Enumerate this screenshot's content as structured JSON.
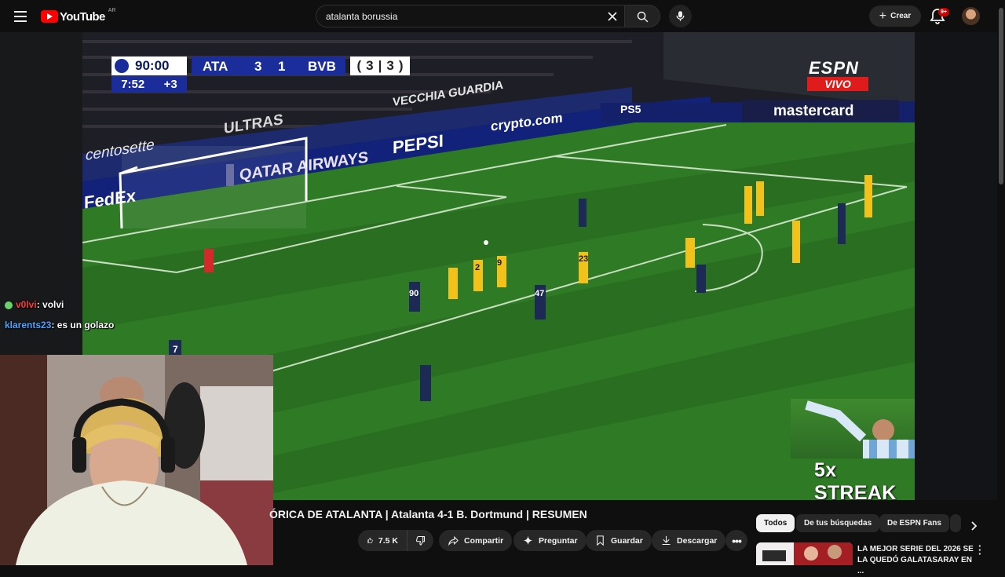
{
  "header": {
    "logo_text": "YouTube",
    "country_code": "AR",
    "search_value": "atalanta borussia",
    "create_label": "Crear",
    "notification_count": "9+"
  },
  "video": {
    "scorebug": {
      "clock": "90:00",
      "home": "ATA",
      "home_score": "3",
      "away_score": "1",
      "away": "BVB",
      "aggregate_home": "3",
      "aggregate_away": "3",
      "stoppage_time": "7:52",
      "added_time": "+3"
    },
    "broadcaster": {
      "name": "ESPN",
      "status": "VIVO"
    },
    "ads": {
      "board_1": "VECCHIA GUARDIA",
      "board_2": "ULTRAS",
      "board_3": "crypto.com",
      "board_4": "PEPSI",
      "board_5": "QATAR AIRWAYS",
      "board_6": "FedEx",
      "board_7": "PS5",
      "board_8": "mastercard",
      "board_9": "centosette"
    },
    "player_numbers": [
      "90",
      "9",
      "2",
      "47",
      "23",
      "7"
    ],
    "streak_overlay": "5x STREAK",
    "chat": [
      {
        "user": "v0lvi",
        "message": ": volvi",
        "user_color": "#ff3b3b"
      },
      {
        "user": "klarents23",
        "message": ": es un golazo",
        "user_color": "#4fa3ff"
      }
    ]
  },
  "title": "ÓRICA DE ATALANTA | Atalanta 4-1 B. Dortmund | RESUMEN",
  "actions": {
    "like_count": "7.5 K",
    "share": "Compartir",
    "ask": "Preguntar",
    "save": "Guardar",
    "download": "Descargar"
  },
  "chips": [
    "Todos",
    "De tus búsquedas",
    "De ESPN Fans"
  ],
  "recommendation": {
    "title": "LA MEJOR SERIE DEL 2026 SE LA QUEDÓ GALATASARAY EN ..."
  },
  "colors": {
    "background": "#0f0f0f",
    "brand_red": "#ff0000",
    "pill": "#272727",
    "atalanta_kit": "#1d2a55",
    "dortmund_kit": "#f2c21a",
    "pitch": "#2e6f23"
  }
}
